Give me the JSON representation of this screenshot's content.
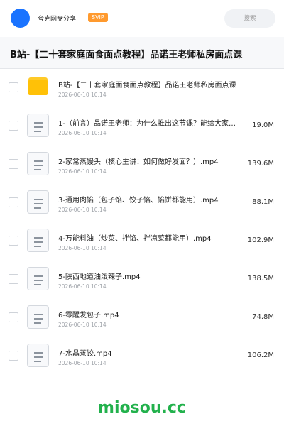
{
  "header": {
    "app_name": "夸克网盘分享",
    "badge": "SVIP",
    "search_label": "搜索"
  },
  "page_title": "B站-【二十套家庭面食面点教程】品诺王老师私房面点课",
  "files": [
    {
      "name": "B站-【二十套家庭面食面点教程】品诺王老师私房面点课",
      "date": "2026-06-10 10:14",
      "size": "",
      "type": "folder"
    },
    {
      "name": "1-（前言）品诺王老师：为什么推出这节课？能给大家…",
      "date": "2026-06-10 10:14",
      "size": "19.0M",
      "type": "file"
    },
    {
      "name": "2-家常蒸馒头（核心主讲：如何做好发面？）.mp4",
      "date": "2026-06-10 10:14",
      "size": "139.6M",
      "type": "file"
    },
    {
      "name": "3-通用肉馅（包子馅、饺子馅、馅饼都能用）.mp4",
      "date": "2026-06-10 10:14",
      "size": "88.1M",
      "type": "file"
    },
    {
      "name": "4-万能料油（炒菜、拌馅、拌凉菜都能用）.mp4",
      "date": "2026-06-10 10:14",
      "size": "102.9M",
      "type": "file"
    },
    {
      "name": "5-陕西地道油泼辣子.mp4",
      "date": "2026-06-10 10:14",
      "size": "138.5M",
      "type": "file"
    },
    {
      "name": "6-零醒发包子.mp4",
      "date": "2026-06-10 10:14",
      "size": "74.8M",
      "type": "file"
    },
    {
      "name": "7-水晶蒸饺.mp4",
      "date": "2026-06-10 10:14",
      "size": "106.2M",
      "type": "file"
    }
  ],
  "watermark": "miosou.cc",
  "colors": {
    "accent": "#1a73ff",
    "badge": "#ff9a2e",
    "folder": "#ffc107",
    "watermark": "#22b14c"
  }
}
